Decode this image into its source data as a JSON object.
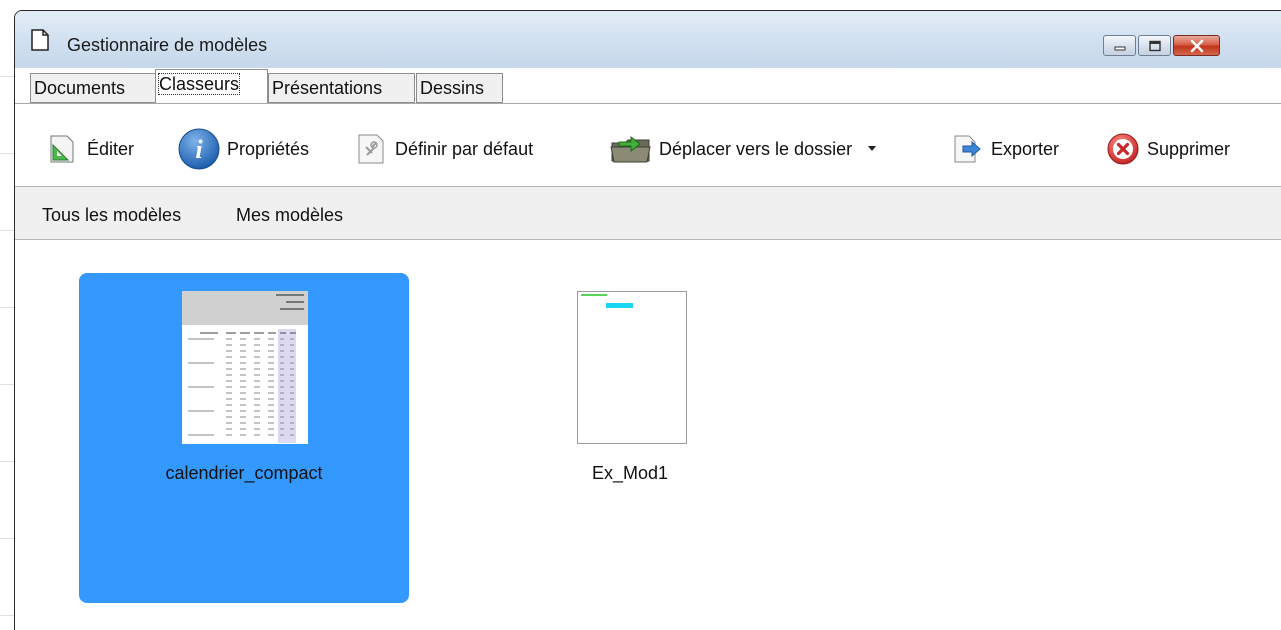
{
  "window": {
    "title": "Gestionnaire de modèles"
  },
  "tabs": [
    {
      "label": "Documents",
      "active": false
    },
    {
      "label": "Classeurs",
      "active": true
    },
    {
      "label": "Présentations",
      "active": false
    },
    {
      "label": "Dessins",
      "active": false
    }
  ],
  "toolbar": {
    "edit": "Éditer",
    "properties": "Propriétés",
    "set_default": "Définir par défaut",
    "move": "Déplacer vers le dossier",
    "export": "Exporter",
    "delete": "Supprimer"
  },
  "filters": {
    "all": "Tous les modèles",
    "mine": "Mes modèles"
  },
  "templates": [
    {
      "name": "calendrier_compact",
      "selected": true
    },
    {
      "name": "Ex_Mod1",
      "selected": false
    }
  ],
  "colors": {
    "selection": "#3399ff",
    "close_button": "#c0351b",
    "info_icon": "#1d5fae"
  },
  "icons": [
    "document-icon",
    "minimize-icon",
    "maximize-icon",
    "close-icon",
    "edit-icon",
    "info-icon",
    "default-icon",
    "move-folder-icon",
    "dropdown-arrow-icon",
    "export-icon",
    "delete-icon"
  ]
}
